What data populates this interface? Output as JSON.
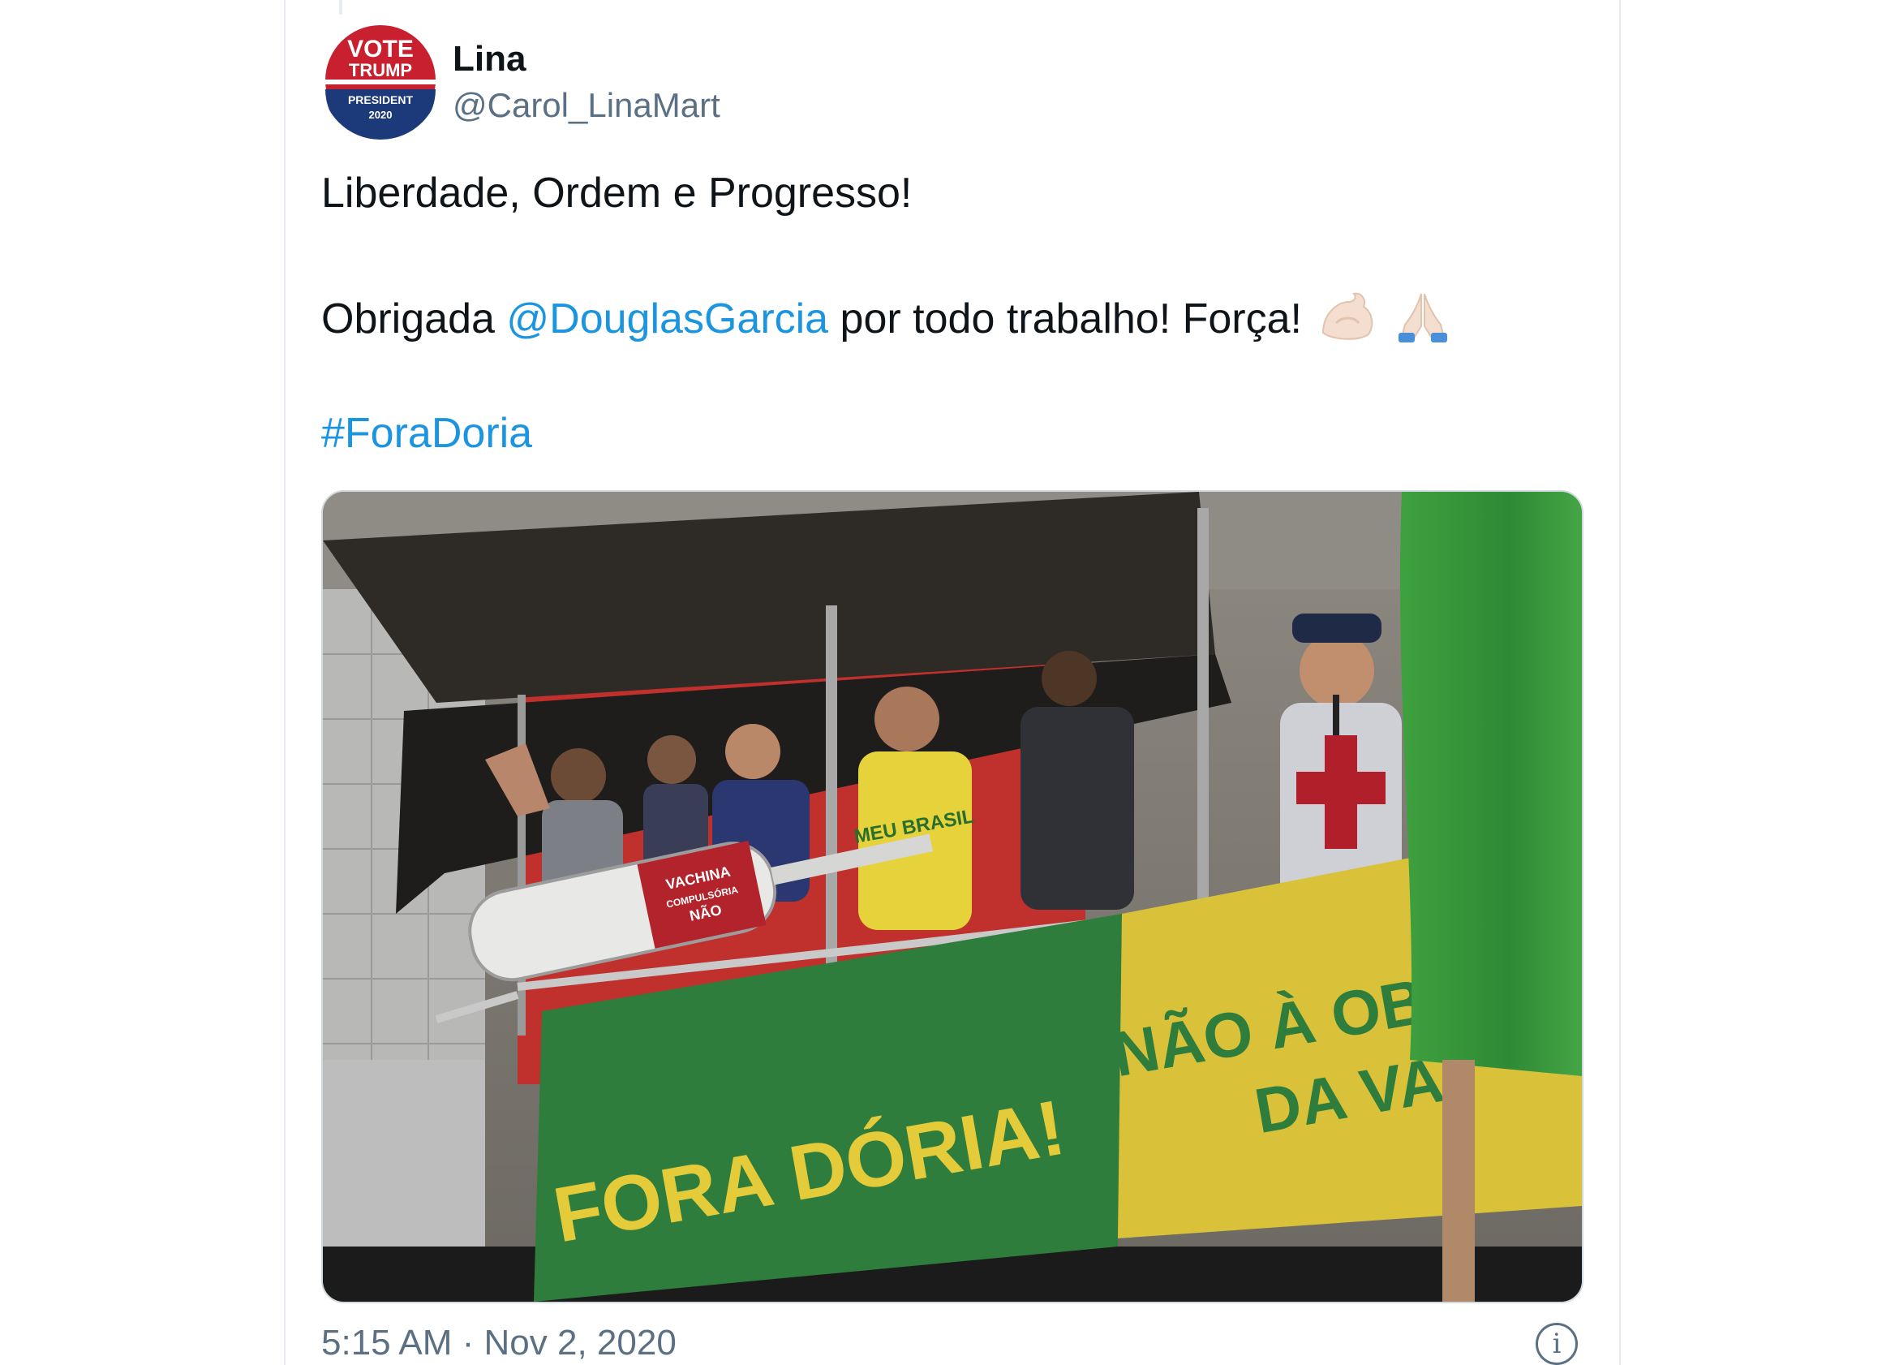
{
  "tweet": {
    "author": {
      "name": "Lina",
      "handle": "@Carol_LinaMart",
      "avatar_badge": {
        "vote": "VOTE",
        "trump": "TRUMP",
        "president": "PRESIDENT",
        "year": "2020"
      }
    },
    "line1": "Liberdade, Ordem e Progresso!",
    "line2_prefix": "Obrigada ",
    "mention": "@DouglasGarcia",
    "line2_suffix": " por todo trabalho! Força!",
    "emojis": [
      "flexed-biceps-icon",
      "folded-hands-icon"
    ],
    "hashtag": "#ForaDoria",
    "media": {
      "banner_green": "FORA DÓRIA!",
      "banner_yellow_line1": "NÃO À OBRI",
      "banner_yellow_line2": "DA VA",
      "syringe_text1": "VACHINA",
      "syringe_text2": "COMPULSÓRIA",
      "syringe_text3": "NÃO",
      "shirt_text": "MEU BRASIL"
    },
    "timestamp": "5:15 AM · Nov 2, 2020",
    "info_icon": "info-icon"
  },
  "colors": {
    "link": "#1b95e0",
    "handle_gray": "#5b7083",
    "text": "#0f1419",
    "banner_green": "#2f7d3c",
    "banner_yellow": "#d9c23a",
    "flag_green": "#3a9a3c"
  }
}
